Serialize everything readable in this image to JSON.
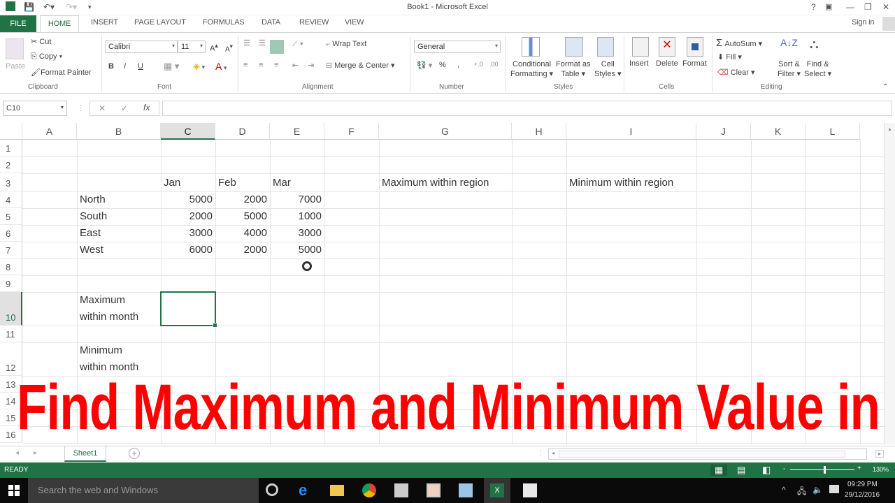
{
  "window": {
    "title": "Book1 - Microsoft Excel",
    "controls": [
      "?",
      "▣",
      "—",
      "❐",
      "✕"
    ],
    "sign_in": "Sign in"
  },
  "ribbon_tabs": [
    "FILE",
    "HOME",
    "INSERT",
    "PAGE LAYOUT",
    "FORMULAS",
    "DATA",
    "REVIEW",
    "VIEW"
  ],
  "ribbon": {
    "clipboard": {
      "paste": "Paste",
      "cut": "Cut",
      "copy": "Copy",
      "format_painter": "Format Painter",
      "group": "Clipboard"
    },
    "font": {
      "name": "Calibri",
      "size": "11",
      "bold": "B",
      "italic": "I",
      "underline": "U",
      "group": "Font"
    },
    "alignment": {
      "wrap_text": "Wrap Text",
      "merge_center": "Merge & Center",
      "group": "Alignment"
    },
    "number": {
      "format": "General",
      "percent": "%",
      "comma": ",",
      "group": "Number"
    },
    "styles": {
      "conditional": "Conditional",
      "conditional2": "Formatting",
      "format_table": "Format as",
      "format_table2": "Table",
      "cell_styles": "Cell",
      "cell_styles2": "Styles",
      "group": "Styles"
    },
    "cells": {
      "insert": "Insert",
      "delete": "Delete",
      "format": "Format",
      "group": "Cells"
    },
    "editing": {
      "autosum": "AutoSum",
      "fill": "Fill",
      "clear": "Clear",
      "sort": "Sort &",
      "sort2": "Filter",
      "find": "Find &",
      "find2": "Select",
      "group": "Editing"
    }
  },
  "formula_bar": {
    "name_box": "C10",
    "cancel": "✕",
    "enter": "✓",
    "fx": "fx",
    "value": ""
  },
  "columns": [
    "A",
    "B",
    "C",
    "D",
    "E",
    "F",
    "G",
    "H",
    "I",
    "J",
    "K",
    "L"
  ],
  "rows": [
    "1",
    "2",
    "3",
    "4",
    "5",
    "6",
    "7",
    "8",
    "9",
    "10",
    "11",
    "12",
    "13",
    "14",
    "15",
    "16"
  ],
  "selected_cell": "C10",
  "sheet": {
    "months": [
      "Jan",
      "Feb",
      "Mar"
    ],
    "regions": [
      {
        "name": "North",
        "values": [
          5000,
          2000,
          7000
        ]
      },
      {
        "name": "South",
        "values": [
          2000,
          5000,
          1000
        ]
      },
      {
        "name": "East",
        "values": [
          3000,
          4000,
          3000
        ]
      },
      {
        "name": "West",
        "values": [
          6000,
          2000,
          5000
        ]
      }
    ],
    "max_region_label": "Maximum within region",
    "min_region_label": "Minimum within region",
    "max_month_label_1": "Maximum",
    "max_month_label_2": "within month",
    "min_month_label_1": "Minimum",
    "min_month_label_2": "within month"
  },
  "overlay_title": "Find Maximum and Minimum Value in Excel",
  "sheet_tabs": [
    "Sheet1"
  ],
  "status": {
    "mode": "READY",
    "zoom": "130%"
  },
  "taskbar": {
    "search_placeholder": "Search the web and Windows",
    "time": "09:29 PM",
    "date": "29/12/2016"
  }
}
